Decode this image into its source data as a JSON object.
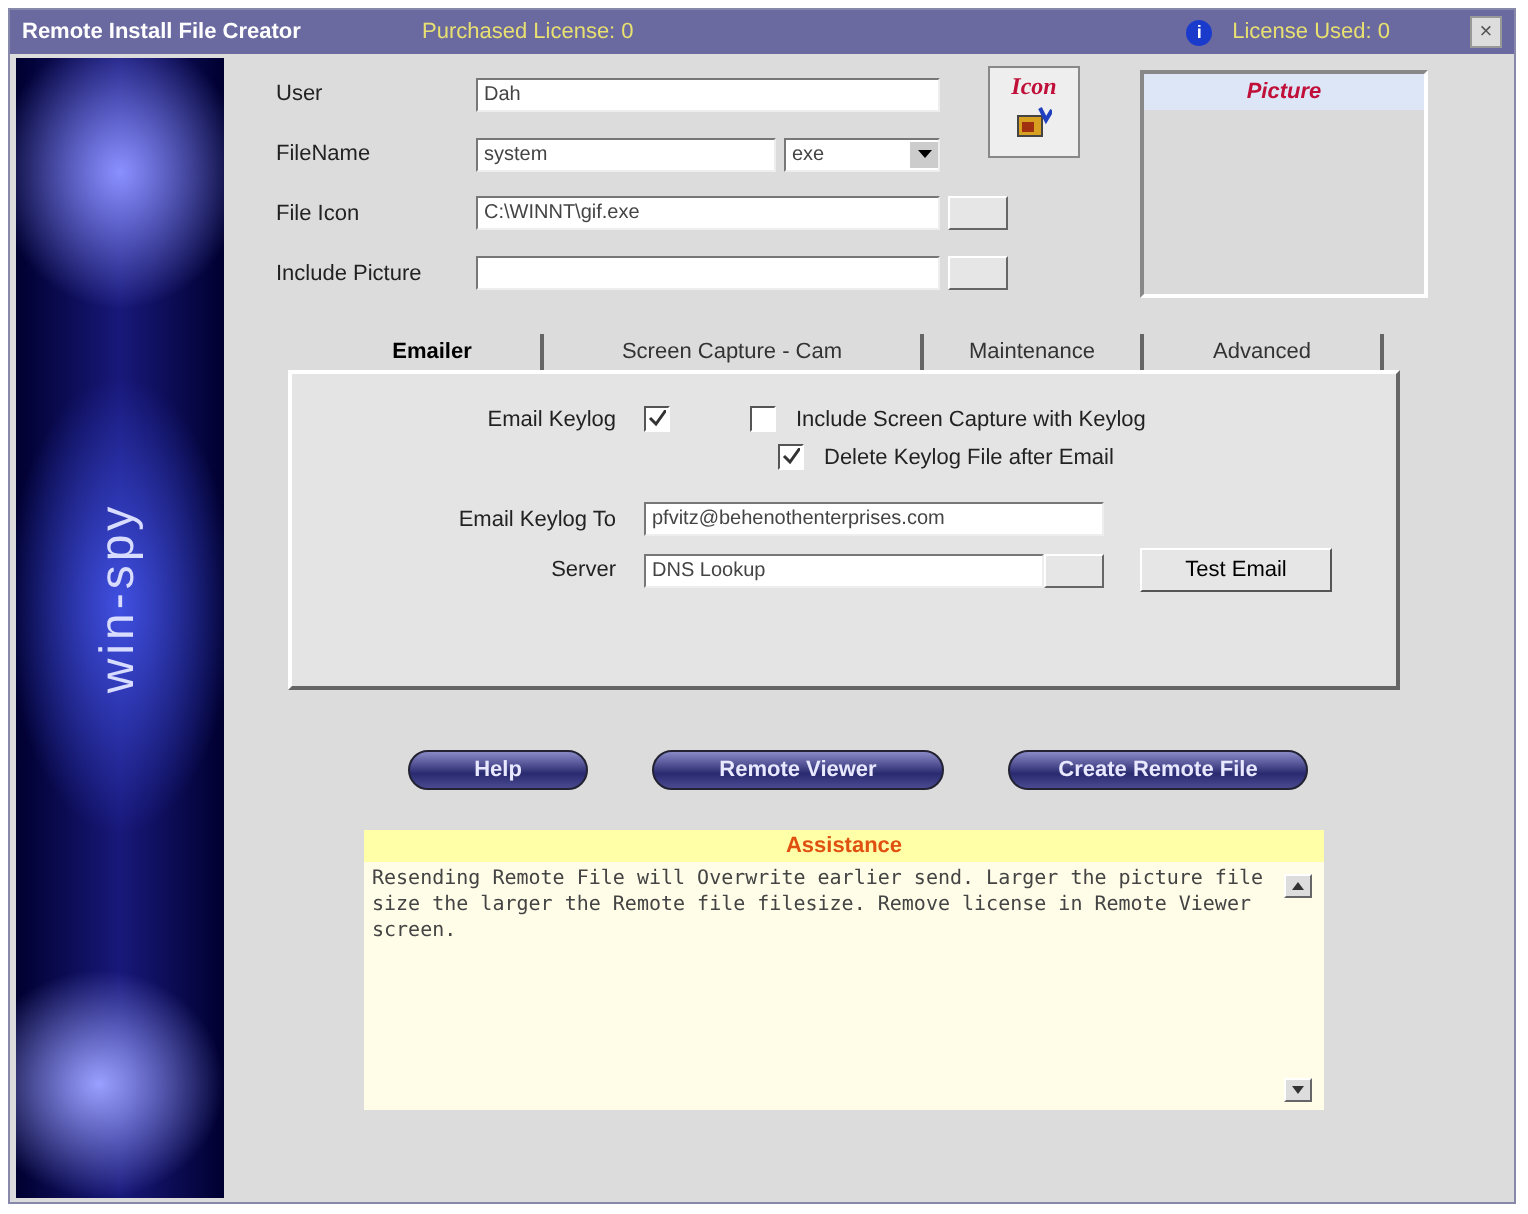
{
  "window": {
    "title": "Remote Install File Creator",
    "purchased_license": "Purchased License: 0",
    "license_used": "License Used: 0",
    "info_icon": "i",
    "close_glyph": "×"
  },
  "sidebar": {
    "logo_text": "win-spy"
  },
  "form": {
    "fields": [
      {
        "label": "User",
        "value": "Dah",
        "kind": "text"
      },
      {
        "label": "FileName",
        "value": "system",
        "kind": "select",
        "select_value": "exe"
      },
      {
        "label": "File Icon",
        "value": "C:\\WINNT\\gif.exe",
        "kind": "browse"
      },
      {
        "label": "Include Picture",
        "kind": "browse"
      }
    ],
    "icon_button": {
      "label": "Icon"
    },
    "picture_panel": {
      "title": "Picture"
    }
  },
  "tabs": [
    {
      "label": "Emailer",
      "selected": true
    },
    {
      "label": "Screen Capture - Cam",
      "selected": false
    },
    {
      "label": "Maintenance",
      "selected": false
    },
    {
      "label": "Advanced",
      "selected": false
    }
  ],
  "emailer": {
    "email_keylog": {
      "label": "Email Keylog",
      "checked": true
    },
    "options": [
      {
        "label": "Include Screen Capture with Keylog",
        "checked": false
      },
      {
        "label": "Delete Keylog File after Email",
        "checked": true
      }
    ],
    "email_to": {
      "label": "Email Keylog To",
      "value": "pfvitz@behenothenterprises.com"
    },
    "server": {
      "label": "Server",
      "value": "DNS Lookup"
    },
    "test_button": "Test Email"
  },
  "buttons": [
    "Help",
    "Remote Viewer",
    "Create Remote File"
  ],
  "assistance": {
    "title": "Assistance",
    "text": "Resending Remote File will Overwrite earlier send. Larger the picture file size the larger the Remote file filesize. Remove license in Remote Viewer screen."
  }
}
